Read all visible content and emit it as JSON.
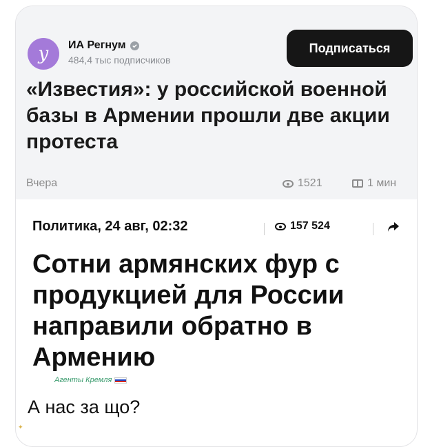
{
  "channel": {
    "avatar_letter": "у",
    "name": "ИА Регнум",
    "subscribers": "484,4 тыс подписчиков"
  },
  "subscribe_button": "Подписаться",
  "post": {
    "headline": "«Известия»: у российской военной базы в Армении прошли две акции протеста",
    "date": "Вчера",
    "views": "1521",
    "read_time": "1 мин"
  },
  "embedded": {
    "category_date": "Политика, 24 авг, 02:32",
    "views": "157 524",
    "title": "Сотни армянских фур с продукцией для России направили обратно в Армению",
    "source": "Агенты Кремля"
  },
  "comment": "А нас за що?",
  "colors": {
    "avatar": "#a47ad9",
    "button": "#161616",
    "source_text": "#3c9c6f"
  },
  "icons": [
    "verified-icon",
    "eye-icon",
    "book-icon",
    "share-icon",
    "russia-flag-icon"
  ]
}
